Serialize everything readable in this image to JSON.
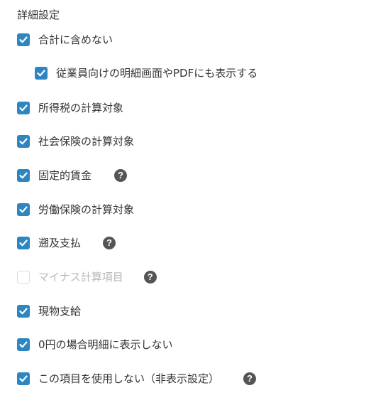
{
  "section": {
    "title": "詳細設定"
  },
  "options": [
    {
      "label": "合計に含めない",
      "checked": true,
      "disabled": false,
      "help": false
    },
    {
      "label": "従業員向けの明細画面やPDFにも表示する",
      "checked": true,
      "disabled": false,
      "help": false
    },
    {
      "label": "所得税の計算対象",
      "checked": true,
      "disabled": false,
      "help": false
    },
    {
      "label": "社会保険の計算対象",
      "checked": true,
      "disabled": false,
      "help": false
    },
    {
      "label": "固定的賃金",
      "checked": true,
      "disabled": false,
      "help": true
    },
    {
      "label": "労働保険の計算対象",
      "checked": true,
      "disabled": false,
      "help": false
    },
    {
      "label": "遡及支払",
      "checked": true,
      "disabled": false,
      "help": true
    },
    {
      "label": "マイナス計算項目",
      "checked": false,
      "disabled": true,
      "help": true
    },
    {
      "label": "現物支給",
      "checked": true,
      "disabled": false,
      "help": false
    },
    {
      "label": "0円の場合明細に表示しない",
      "checked": true,
      "disabled": false,
      "help": false
    },
    {
      "label": "この項目を使用しない（非表示設定）",
      "checked": true,
      "disabled": false,
      "help": true
    }
  ],
  "help_glyph": "?",
  "colors": {
    "checkbox_checked": "#2e86c1",
    "checkbox_disabled_border": "#dcdcdc",
    "help_icon_bg": "#555555",
    "text": "#333333",
    "text_disabled": "#b8b8b8"
  }
}
